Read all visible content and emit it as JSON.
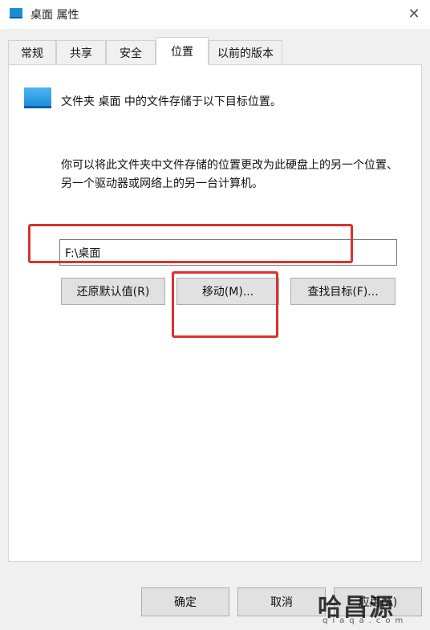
{
  "window": {
    "title": "桌面 属性",
    "close_glyph": "✕"
  },
  "tabs": [
    {
      "label": "常规",
      "active": false
    },
    {
      "label": "共享",
      "active": false
    },
    {
      "label": "安全",
      "active": false
    },
    {
      "label": "位置",
      "active": true
    },
    {
      "label": "以前的版本",
      "active": false
    }
  ],
  "location": {
    "info": "文件夹 桌面 中的文件存储于以下目标位置。",
    "description": "你可以将此文件夹中文件存储的位置更改为此硬盘上的另一个位置、另一个驱动器或网络上的另一台计算机。",
    "path_value": "F:\\桌面",
    "restore_label": "还原默认值(R)",
    "move_label": "移动(M)...",
    "find_label": "查找目标(F)..."
  },
  "footer": {
    "ok_label": "确定",
    "cancel_label": "取消",
    "apply_label": "应用(A)"
  },
  "watermark": {
    "main": "哈昌源",
    "sub": "qiaqa.com"
  },
  "colors": {
    "highlight": "#d9332e",
    "folder": "#1e8fdc"
  },
  "icons": {
    "title": "folder-icon",
    "close": "close-icon",
    "folder": "folder-icon"
  }
}
